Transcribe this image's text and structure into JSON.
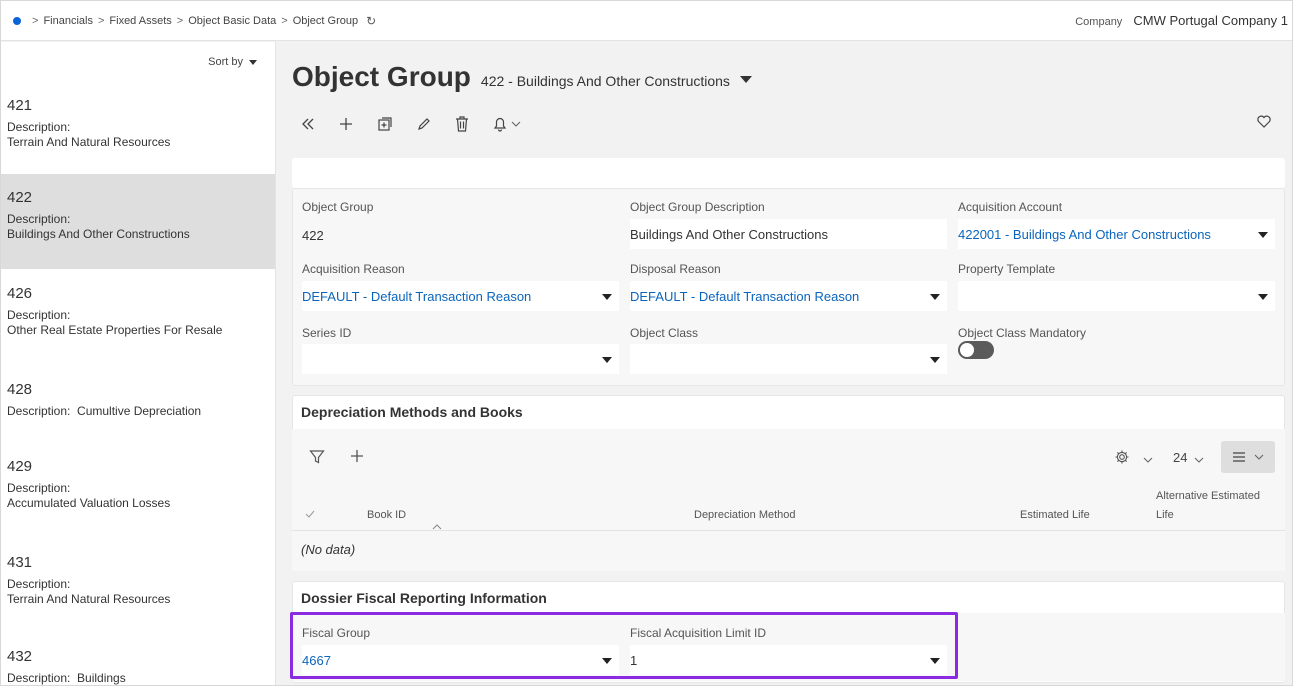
{
  "breadcrumb": {
    "items": [
      "Financials",
      "Fixed Assets",
      "Object Basic Data",
      "Object Group"
    ]
  },
  "company": {
    "label": "Company",
    "value": "CMW Portugal Company 1"
  },
  "list": {
    "sort_label": "Sort by",
    "items": [
      {
        "code": "421",
        "desc_label": "Description:",
        "desc": "Terrain And Natural Resources"
      },
      {
        "code": "422",
        "desc_label": "Description:",
        "desc": "Buildings And Other Constructions"
      },
      {
        "code": "426",
        "desc_label": "Description:",
        "desc": "Other Real Estate Properties For Resale"
      },
      {
        "code": "428",
        "desc_label": "Description:",
        "desc": "Cumultive Depreciation"
      },
      {
        "code": "429",
        "desc_label": "Description:",
        "desc": "Accumulated Valuation Losses"
      },
      {
        "code": "431",
        "desc_label": "Description:",
        "desc": "Terrain And Natural Resources"
      },
      {
        "code": "432",
        "desc_label": "Description:",
        "desc": "Buildings"
      }
    ]
  },
  "header": {
    "title": "Object Group",
    "subtitle": "422 - Buildings And Other Constructions"
  },
  "form": {
    "object_group": {
      "label": "Object Group",
      "value": "422"
    },
    "object_group_description": {
      "label": "Object Group Description",
      "value": "Buildings And Other Constructions"
    },
    "acquisition_account": {
      "label": "Acquisition Account",
      "value": "422001 - Buildings And Other Constructions"
    },
    "acquisition_reason": {
      "label": "Acquisition Reason",
      "value": "DEFAULT - Default  Transaction Reason"
    },
    "disposal_reason": {
      "label": "Disposal Reason",
      "value": "DEFAULT - Default  Transaction Reason"
    },
    "property_template": {
      "label": "Property Template",
      "value": ""
    },
    "series_id": {
      "label": "Series ID",
      "value": ""
    },
    "object_class": {
      "label": "Object Class",
      "value": ""
    },
    "object_class_mandatory": {
      "label": "Object Class Mandatory",
      "checked": false
    }
  },
  "depreciation": {
    "title": "Depreciation Methods and Books",
    "page_size": "24",
    "columns": [
      "Book ID",
      "Depreciation Method",
      "Estimated Life",
      "Alternative Estimated",
      "Life"
    ],
    "empty_text": "(No data)"
  },
  "dossier": {
    "title": "Dossier Fiscal Reporting Information",
    "fiscal_group": {
      "label": "Fiscal Group",
      "value": "4667"
    },
    "fiscal_acquisition_limit": {
      "label": "Fiscal Acquisition Limit ID",
      "value": "1"
    }
  },
  "colors": {
    "link": "#0b65bd",
    "highlight": "#8a2be2",
    "selected_row": "#dedede"
  }
}
